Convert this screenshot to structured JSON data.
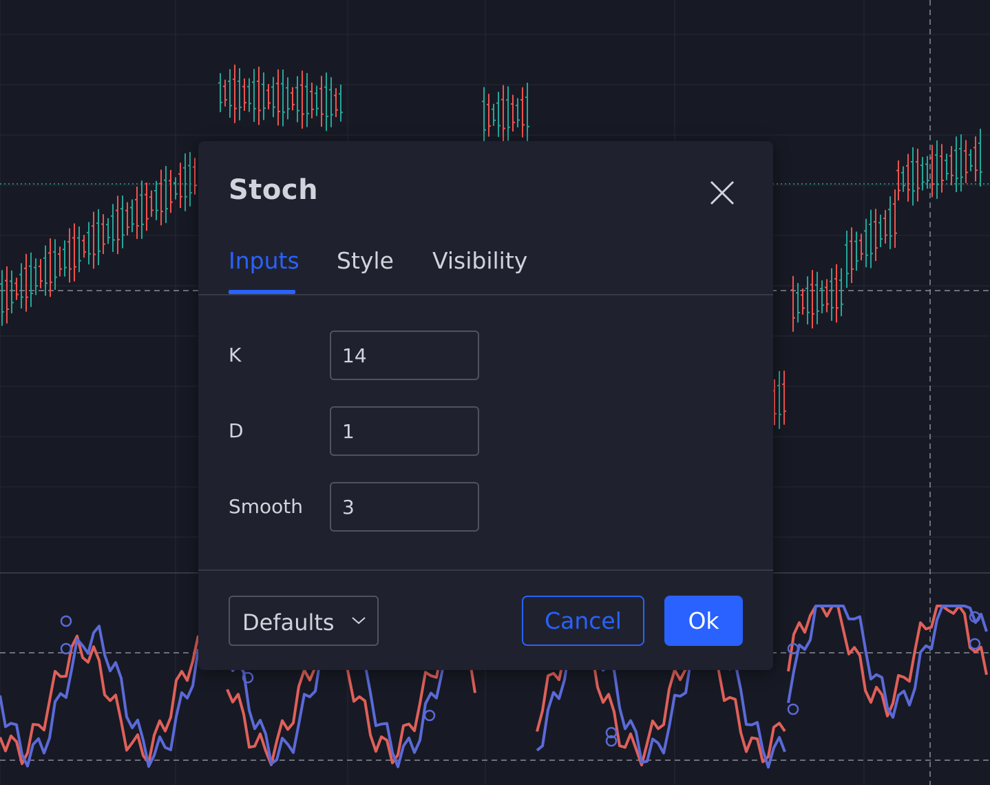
{
  "dialog": {
    "title": "Stoch",
    "tabs": [
      {
        "label": "Inputs",
        "active": true
      },
      {
        "label": "Style",
        "active": false
      },
      {
        "label": "Visibility",
        "active": false
      }
    ],
    "fields": [
      {
        "label": "K",
        "value": "14"
      },
      {
        "label": "D",
        "value": "1"
      },
      {
        "label": "Smooth",
        "value": "3"
      }
    ],
    "footer": {
      "defaults_label": "Defaults",
      "cancel_label": "Cancel",
      "ok_label": "Ok"
    }
  },
  "colors": {
    "background": "#171a24",
    "dialog": "#1f222e",
    "accent": "#2962ff",
    "candle_up": "#26a69a",
    "candle_down": "#ef5350",
    "stoch_k": "#5b6ad8",
    "stoch_d": "#e0605a"
  },
  "icons": {
    "close": "close-icon",
    "dropdown": "chevron-down-icon"
  }
}
